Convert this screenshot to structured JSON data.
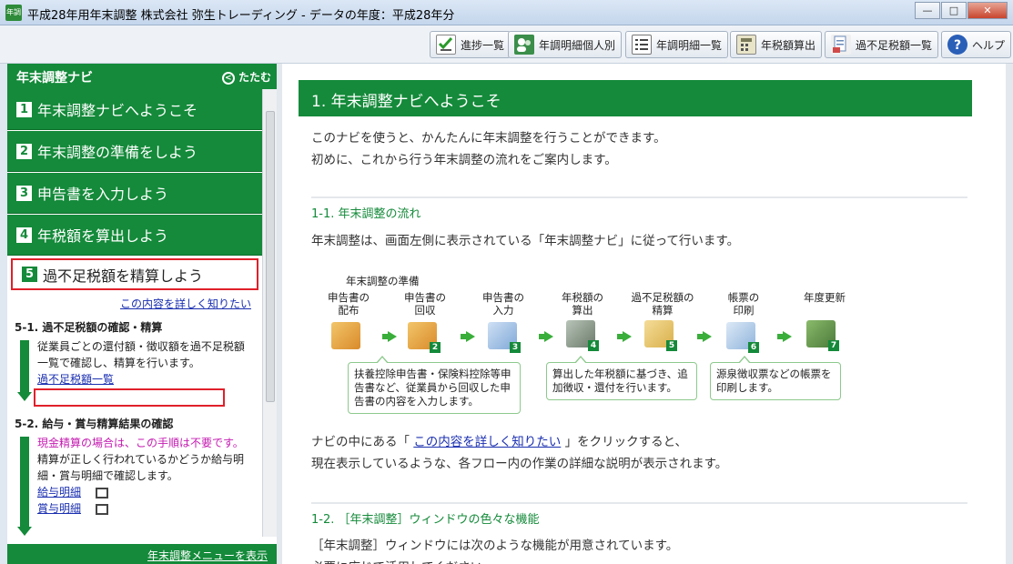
{
  "window": {
    "app_icon": "年調",
    "title": "平成28年用年末調整 株式会社 弥生トレーディング - データの年度：平成28年分",
    "min": "—",
    "max": "□",
    "close": "✕"
  },
  "toolbar": [
    {
      "label": "進捗一覧",
      "icon": "progress-icon"
    },
    {
      "label": "年調明細個人別",
      "icon": "persons-icon"
    },
    {
      "label": "年調明細一覧",
      "icon": "list-icon"
    },
    {
      "label": "年税額算出",
      "icon": "calculator-icon"
    },
    {
      "label": "過不足税額一覧",
      "icon": "tax-list-icon"
    },
    {
      "label": "ヘルプ",
      "icon": "help-icon"
    }
  ],
  "nav": {
    "title": "年末調整ナビ",
    "collapse_label": "たたむ",
    "steps": [
      {
        "num": "1",
        "label": "年末調整ナビへようこそ"
      },
      {
        "num": "2",
        "label": "年末調整の準備をしよう"
      },
      {
        "num": "3",
        "label": "申告書を入力しよう"
      },
      {
        "num": "4",
        "label": "年税額を算出しよう"
      },
      {
        "num": "5",
        "label": "過不足税額を精算しよう"
      }
    ],
    "detail_link": "この内容を詳しく知りたい",
    "section1": {
      "title": "5-1. 過不足税額の確認・精算",
      "text": "従業員ごとの還付額・徴収額を過不足税額一覧で確認し、精算を行います。",
      "link": "過不足税額一覧"
    },
    "section2": {
      "title": "5-2. 給与・賞与精算結果の確認",
      "note": "現金精算の場合は、この手順は不要です。",
      "text": "精算が正しく行われているかどうか給与明細・賞与明細で確認します。",
      "links": [
        "給与明細",
        "賞与明細"
      ]
    },
    "footer_link": "年末調整メニューを表示"
  },
  "content": {
    "header": "1. 年末調整ナビへようこそ",
    "intro1": "このナビを使うと、かんたんに年末調整を行うことができます。",
    "intro2": "初めに、これから行う年末調整の流れをご案内します。",
    "sub1": "1-1. 年末調整の流れ",
    "flow_intro": "年末調整は、画面左側に表示されている「年末調整ナビ」に従って行います。",
    "flow_group_label": "年末調整の準備",
    "flow_steps": [
      {
        "label1": "申告書の",
        "label2": "配布",
        "num": "",
        "color": "#d98a2a"
      },
      {
        "label1": "申告書の",
        "label2": "回収",
        "num": "2",
        "color": "#d98a2a"
      },
      {
        "label1": "申告書の",
        "label2": "入力",
        "num": "3",
        "color": "#7fa8d8"
      },
      {
        "label1": "年税額の",
        "label2": "算出",
        "num": "4",
        "color": "#6a7a6a"
      },
      {
        "label1": "過不足税額の",
        "label2": "精算",
        "num": "5",
        "color": "#d9b04a"
      },
      {
        "label1": "帳票の",
        "label2": "印刷",
        "num": "6",
        "color": "#8fb4dc"
      },
      {
        "label1": "年度更新",
        "label2": "",
        "num": "7",
        "color": "#4a7a3a"
      }
    ],
    "bubbles": [
      "扶養控除申告書・保険料控除等申告書など、従業員から回収した申告書の内容を入力します。",
      "算出した年税額に基づき、追加徴収・還付を行います。",
      "源泉徴収票などの帳票を印刷します。"
    ],
    "nav_note_prefix": "ナビの中にある「 ",
    "nav_note_link": "この内容を詳しく知りたい",
    "nav_note_suffix": " 」をクリックすると、",
    "nav_note2": "現在表示しているような、各フロー内の作業の詳細な説明が表示されます。",
    "sub2": "1-2. ［年末調整］ウィンドウの色々な機能",
    "features_intro": "［年末調整］ウィンドウには次のような機能が用意されています。",
    "features_more": "必要に応じて活用してください。"
  }
}
